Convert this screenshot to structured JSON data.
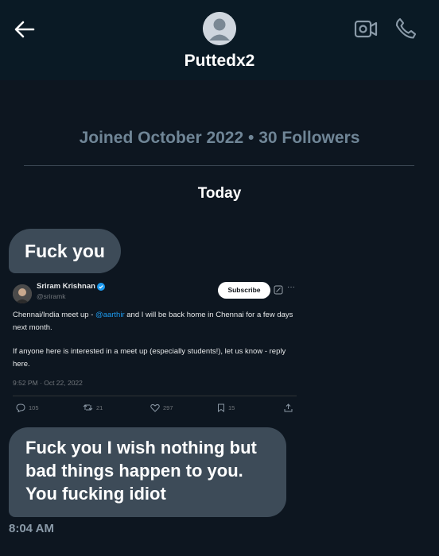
{
  "header": {
    "contact_name": "Puttedx2",
    "back_icon": "arrow-left-icon",
    "video_icon": "video-call-icon",
    "phone_icon": "phone-icon"
  },
  "profile": {
    "joined_line": "Joined October 2022 • 30 Followers"
  },
  "conversation": {
    "day_label": "Today",
    "messages": [
      {
        "text": "Fuck you"
      },
      {
        "lines": [
          "Fuck you I wish nothing but",
          "bad things happen to you.",
          "You fucking idiot"
        ]
      }
    ],
    "timestamp": "8:04 AM"
  },
  "tweet": {
    "author": "Sriram Krishnan",
    "handle": "@sriramk",
    "subscribe_label": "Subscribe",
    "more": "···",
    "text_before_mention": "Chennai/India meet up - ",
    "mention": "@aarthir",
    "text_after_mention": " and I will be back home in Chennai for a few days next month.",
    "paragraph2": "If anyone here is interested in a meet up (especially students!), let us know - reply here.",
    "time": "9:52 PM · Oct 22, 2022",
    "replies": "105",
    "retweets": "21",
    "likes": "297",
    "bookmarks": "15"
  },
  "colors": {
    "background": "#0d1620",
    "header_bg": "#0a1a25",
    "bubble": "#3d4b58",
    "muted_text": "#6f8596",
    "link_blue": "#1d9bf0"
  }
}
